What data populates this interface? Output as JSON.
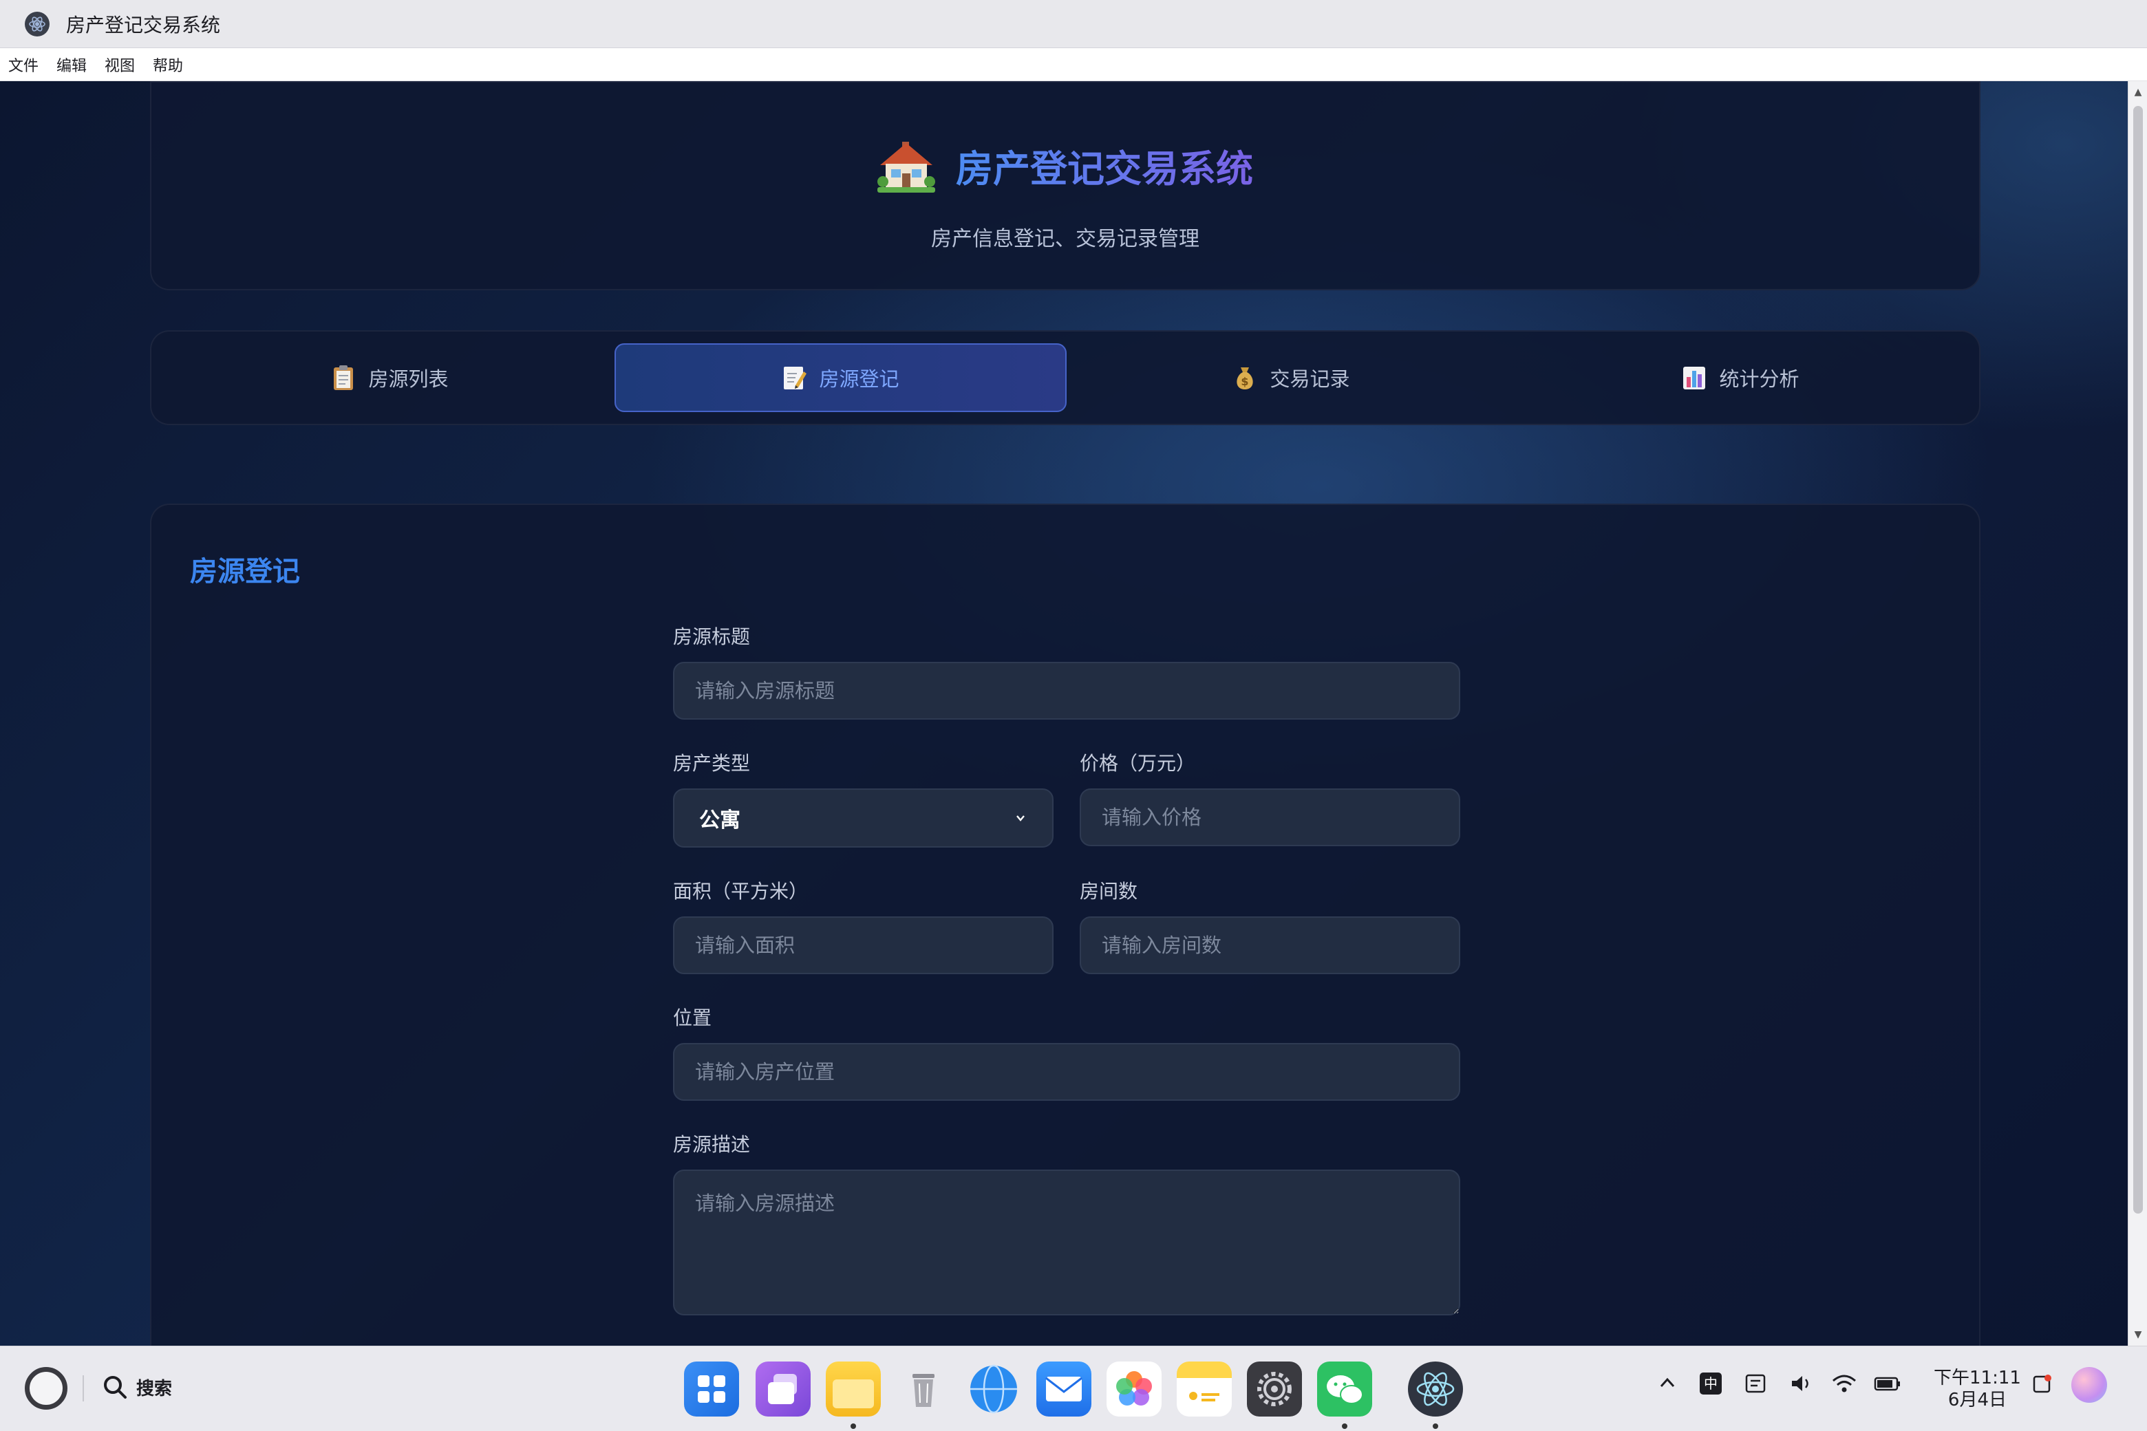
{
  "window": {
    "title": "房产登记交易系统"
  },
  "menubar": {
    "items": [
      "文件",
      "编辑",
      "视图",
      "帮助"
    ]
  },
  "header": {
    "title": "房产登记交易系统",
    "subtitle": "房产信息登记、交易记录管理",
    "icon": "house-icon"
  },
  "nav": {
    "tabs": [
      {
        "label": "房源列表",
        "icon": "clipboard-icon",
        "active": false
      },
      {
        "label": "房源登记",
        "icon": "memo-icon",
        "active": true
      },
      {
        "label": "交易记录",
        "icon": "money-bag-icon",
        "active": false
      },
      {
        "label": "统计分析",
        "icon": "bar-chart-icon",
        "active": false
      }
    ]
  },
  "form": {
    "section_title": "房源登记",
    "title_label": "房源标题",
    "title_placeholder": "请输入房源标题",
    "type_label": "房产类型",
    "type_value": "公寓",
    "price_label": "价格（万元）",
    "price_placeholder": "请输入价格",
    "area_label": "面积（平方米）",
    "area_placeholder": "请输入面积",
    "rooms_label": "房间数",
    "rooms_placeholder": "请输入房间数",
    "location_label": "位置",
    "location_placeholder": "请输入房产位置",
    "desc_label": "房源描述",
    "desc_placeholder": "请输入房源描述"
  },
  "taskbar": {
    "search_label": "搜索",
    "dock": [
      "app-grid-icon",
      "multitask-icon",
      "files-icon",
      "trash-icon",
      "browser-icon",
      "mail-icon",
      "photos-icon",
      "notes-icon",
      "settings-icon",
      "wechat-icon",
      "electron-icon"
    ],
    "clock_time": "下午11:11",
    "clock_date": "6月4日",
    "ime_label": "中"
  },
  "colors": {
    "accent": "#3c86f0",
    "title_gradient_start": "#4d8cf2",
    "title_gradient_end": "#7a63e6",
    "background": "#0d1731",
    "input_bg": "#222d42"
  }
}
